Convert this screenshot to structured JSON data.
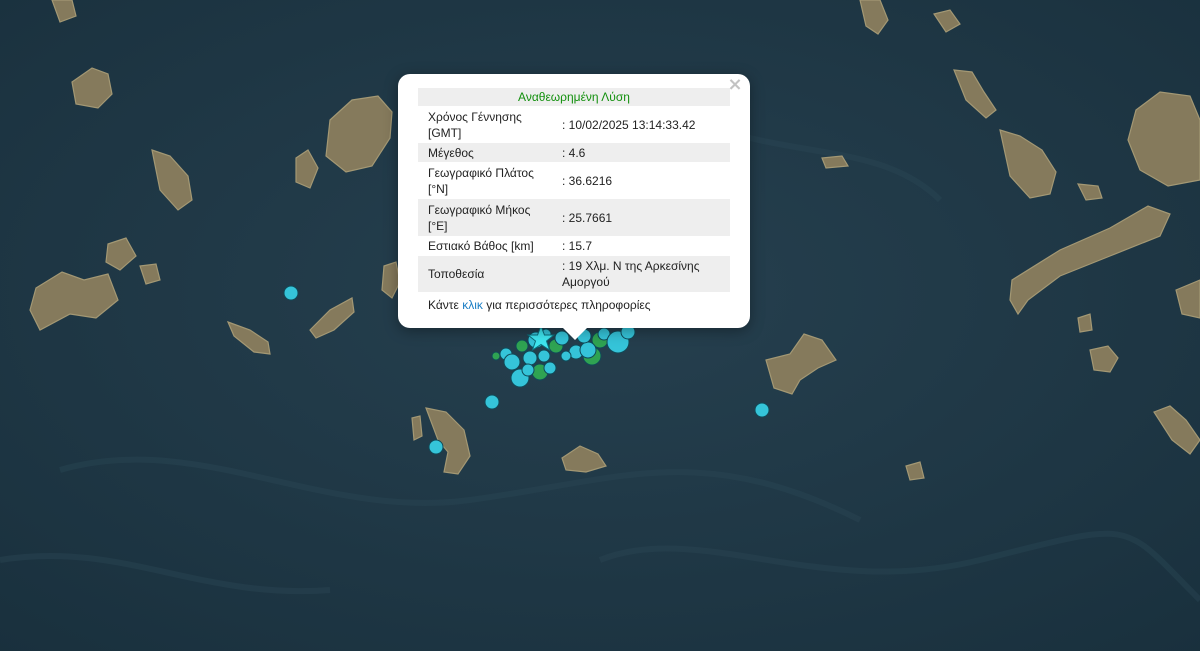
{
  "popup": {
    "title": "Αναθεωρημένη Λύση",
    "rows": [
      {
        "label": "Χρόνος Γέννησης [GMT]",
        "value": ": 10/02/2025 13:14:33.42"
      },
      {
        "label": "Μέγεθος",
        "value": ": 4.6"
      },
      {
        "label": "Γεωγραφικό Πλάτος [°N]",
        "value": ": 36.6216"
      },
      {
        "label": "Γεωγραφικό Μήκος [°E]",
        "value": ": 25.7661"
      },
      {
        "label": "Εστιακό Βάθος [km]",
        "value": ": 15.7"
      },
      {
        "label": "Τοποθεσία",
        "value": ": 19 Χλμ. Ν της Αρκεσίνης Αμοργού"
      }
    ],
    "more_prefix": "Κάντε ",
    "more_link": "κλικ",
    "more_suffix": " για περισσότερες πληροφορίες",
    "close_symbol": "×"
  },
  "colors": {
    "sea": "#1f3644",
    "land": "#857a5c",
    "marker_cyan": "#35c4d9",
    "marker_green": "#2fa352",
    "star": "#3fe6f0"
  },
  "icons": {
    "main_event": "star-icon",
    "close": "close-icon"
  }
}
